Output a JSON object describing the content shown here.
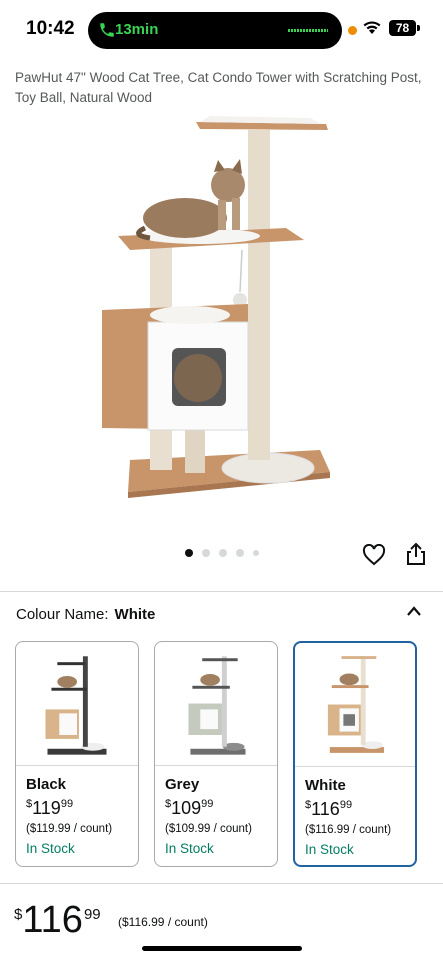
{
  "status_bar": {
    "time": "10:42",
    "call_duration": "13min",
    "battery": "78"
  },
  "product": {
    "title": "PawHut 47\" Wood Cat Tree, Cat Condo Tower with Scratching Post, Toy Ball, Natural Wood",
    "image_icon": "cat-tree-image",
    "image_count": 5,
    "active_image": 1
  },
  "colour": {
    "label": "Colour Name:",
    "selected": "White"
  },
  "swatches": [
    {
      "name": "Black",
      "currency": "$",
      "whole": "119",
      "fraction": "99",
      "unit": "($119.99 / count)",
      "stock": "In Stock",
      "selected": false
    },
    {
      "name": "Grey",
      "currency": "$",
      "whole": "109",
      "fraction": "99",
      "unit": "($109.99 / count)",
      "stock": "In Stock",
      "selected": false
    },
    {
      "name": "White",
      "currency": "$",
      "whole": "116",
      "fraction": "99",
      "unit": "($116.99 / count)",
      "stock": "In Stock",
      "selected": true
    }
  ],
  "price": {
    "currency": "$",
    "whole": "116",
    "fraction": "99",
    "unit": "($116.99 / count)"
  },
  "colors": {
    "accent_selected": "#2162a1",
    "in_stock": "#067d62",
    "call_green": "#39d353"
  }
}
